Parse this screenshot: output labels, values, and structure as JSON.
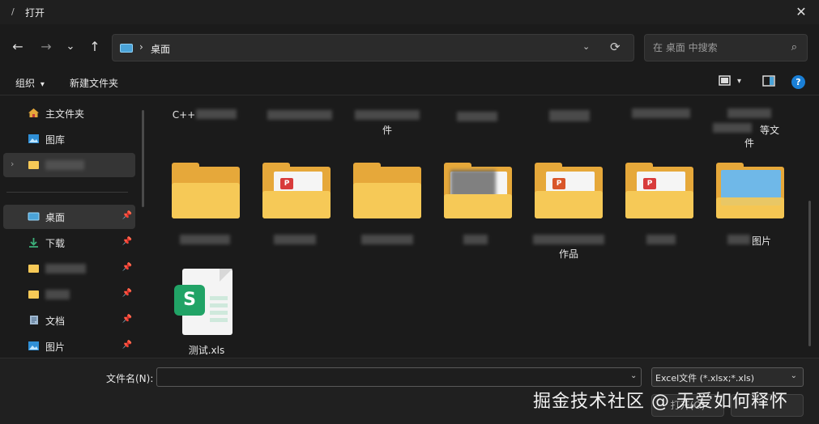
{
  "window": {
    "title": "打开",
    "close": "✕"
  },
  "nav": {
    "back": "←",
    "forward": "→",
    "recent": "⌄",
    "up": "↑",
    "address": "桌面",
    "separator": "›",
    "dropdown": "⌄",
    "refresh": "⟳",
    "search_placeholder": "在 桌面 中搜索",
    "search_icon": "⌕"
  },
  "toolbar": {
    "organize": "组织",
    "organize_caret": "▾",
    "new_folder": "新建文件夹",
    "view_caret": "▾",
    "help": "?"
  },
  "sidebar": {
    "items": [
      {
        "label": "主文件夹",
        "icon": "home-icon"
      },
      {
        "label": "图库",
        "icon": "gallery-icon"
      },
      {
        "label": "",
        "icon": "folder-icon",
        "blurred": true,
        "selected": true
      },
      {
        "label": "桌面",
        "icon": "desktop-icon",
        "selected": true,
        "pinned": true
      },
      {
        "label": "下载",
        "icon": "download-icon",
        "pinned": true
      },
      {
        "label": "",
        "icon": "folder-icon",
        "blurred": true,
        "pinned": true
      },
      {
        "label": "",
        "icon": "folder-icon",
        "blurred": true,
        "pinned": true
      },
      {
        "label": "文档",
        "icon": "document-icon",
        "pinned": true
      },
      {
        "label": "图片",
        "icon": "pictures-icon",
        "pinned": true
      }
    ],
    "pin_glyph": "📌",
    "expand": "›"
  },
  "files": {
    "top_row_labels": [
      "C++",
      "",
      "件",
      "",
      "",
      "",
      "等文",
      "件"
    ],
    "folder_row": [
      {
        "label": "",
        "type": "folder"
      },
      {
        "label": "",
        "type": "folder-pdf",
        "badge": "P"
      },
      {
        "label": "",
        "type": "folder"
      },
      {
        "label": "",
        "type": "folder-image"
      },
      {
        "label": "作品",
        "type": "folder-ppt",
        "badge": "P"
      },
      {
        "label": "",
        "type": "folder-pdf",
        "badge": "P"
      },
      {
        "label": "图片",
        "type": "folder-photo"
      }
    ],
    "xls_file": {
      "label": "测试.xls",
      "badge": "S"
    }
  },
  "bottom": {
    "filename_label": "文件名(N):",
    "filename_value": "",
    "filetype": "Excel文件 (*.xlsx;*.xls)",
    "open_label": "打开(O)",
    "caret": "⌄"
  },
  "watermark": "掘金技术社区 @ 无爱如何释怀",
  "colors": {
    "accent": "#1a7fd6",
    "folder": "#f6c957",
    "excel": "#21a366",
    "pdf": "#d83b3b",
    "ppt": "#d9562a"
  }
}
